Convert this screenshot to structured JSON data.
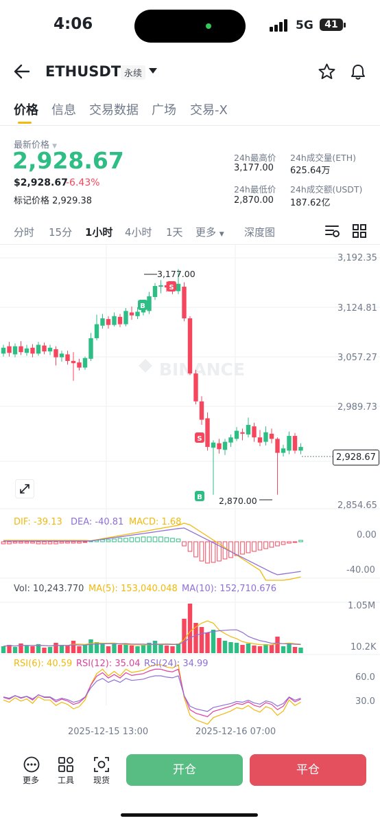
{
  "status_bar": {
    "time": "4:06",
    "network": "5G",
    "battery": "41"
  },
  "header": {
    "symbol": "ETHUSDT",
    "badge": "永续"
  },
  "tabs": [
    "价格",
    "信息",
    "交易数据",
    "广场",
    "交易-X"
  ],
  "price": {
    "last_label": "最新价格",
    "last": "2,928.67",
    "usd": "$2,928.67",
    "change_pct": "-6.43%",
    "mark_label": "标记价格 2,929.38"
  },
  "stats": {
    "high_label": "24h最高价",
    "high": "3,177.00",
    "vol_eth_label": "24h成交量(ETH)",
    "vol_eth": "625.64万",
    "low_label": "24h最低价",
    "low": "2,870.00",
    "vol_usdt_label": "24h成交额(USDT)",
    "vol_usdt": "187.62亿"
  },
  "intervals": [
    "分时",
    "15分",
    "1小时",
    "4小时",
    "1天",
    "更多",
    "深度图"
  ],
  "price_axis": [
    "3,192.35",
    "3,124.81",
    "3,057.27",
    "2,989.73",
    "2,854.65"
  ],
  "current_price_tag": "2,928.67",
  "annotations": {
    "high": "3,177.00",
    "low": "2,870.00",
    "buy": "B",
    "sell": "S"
  },
  "watermark": "BINANCE",
  "macd": {
    "dif": "DIF: -39.13",
    "dea": "DEA: -40.81",
    "macd": "MACD: 1.68",
    "axis": [
      "0.00",
      "-40.00"
    ]
  },
  "volume": {
    "vol": "Vol: 10,243.770",
    "ma5": "MA(5): 153,040.048",
    "ma10": "MA(10): 152,710.676",
    "axis": [
      "1.05M",
      "10.2K"
    ]
  },
  "rsi": {
    "rsi6": "RSI(6): 40.59",
    "rsi12": "RSI(12): 35.04",
    "rsi24": "RSI(24): 34.99",
    "axis": [
      "60.0",
      "30.0"
    ]
  },
  "time_axis": [
    "2025-12-15 13:00",
    "2025-12-16 07:00"
  ],
  "toolbar": {
    "more": "更多",
    "tools": "工具",
    "spot": "现货",
    "open": "开仓",
    "close": "平仓"
  },
  "colors": {
    "up": "#2ebd85",
    "down": "#f6465d",
    "accent": "#f0b90b"
  }
}
